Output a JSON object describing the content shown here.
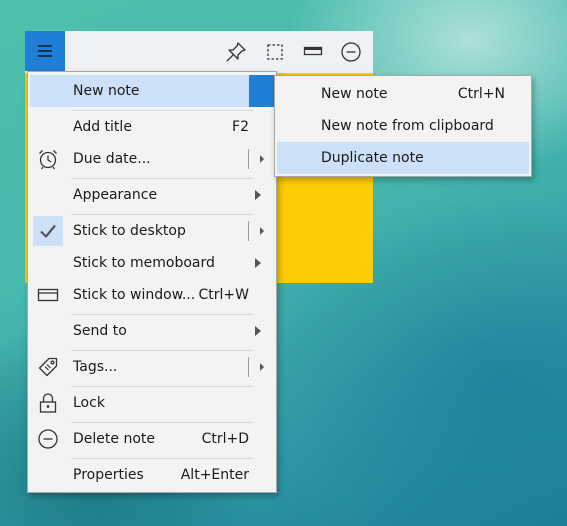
{
  "colors": {
    "note_yellow": "#fecc02",
    "accent_blue": "#1f7fd6",
    "highlight": "#cce0f7",
    "menu_bg": "#f3f3f3"
  },
  "toolbar": {
    "icons": [
      "menu-icon",
      "pin-icon",
      "select-icon",
      "window-icon",
      "minimize-circle-icon"
    ]
  },
  "main_menu": {
    "new_note": "New note",
    "add_title": "Add title",
    "add_title_shortcut": "F2",
    "due_date": "Due date...",
    "appearance": "Appearance",
    "stick_to_desktop": "Stick to desktop",
    "stick_to_memoboard": "Stick to memoboard",
    "stick_to_window": "Stick to window...",
    "stick_to_window_shortcut": "Ctrl+W",
    "send_to": "Send to",
    "tags": "Tags...",
    "lock": "Lock",
    "delete_note": "Delete note",
    "delete_note_shortcut": "Ctrl+D",
    "properties": "Properties",
    "properties_shortcut": "Alt+Enter"
  },
  "sub_menu": {
    "new_note": "New note",
    "new_note_shortcut": "Ctrl+N",
    "new_note_from_clipboard": "New note from clipboard",
    "duplicate_note": "Duplicate note"
  }
}
